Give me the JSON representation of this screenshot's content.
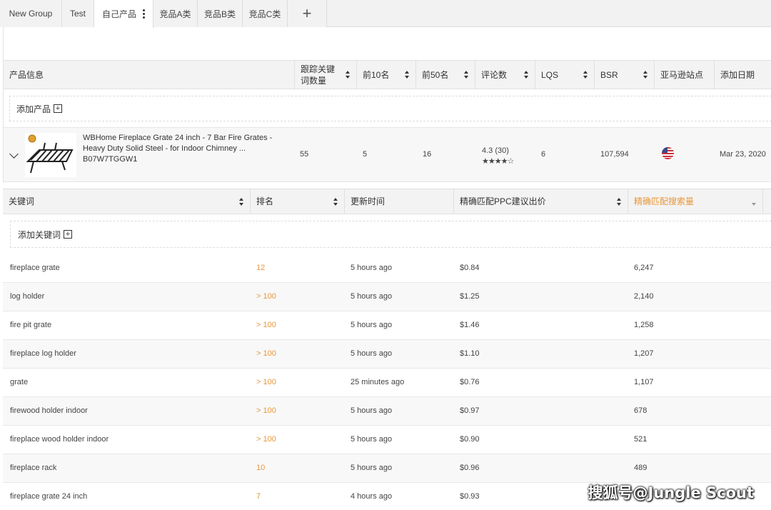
{
  "tabs": [
    {
      "label": "New Group",
      "active": false
    },
    {
      "label": "Test",
      "active": false
    },
    {
      "label": "自己产品",
      "active": true
    },
    {
      "label": "竞品A类",
      "active": false
    },
    {
      "label": "竞品B类",
      "active": false
    },
    {
      "label": "竞品C类",
      "active": false
    }
  ],
  "product_table": {
    "headers": [
      "产品信息",
      "跟踪关键词数量",
      "前10名",
      "前50名",
      "评论数",
      "LQS",
      "BSR",
      "亚马逊站点",
      "添加日期"
    ],
    "add_product_label": "添加产品",
    "product": {
      "title": "WBHome Fireplace Grate 24 inch - 7 Bar Fire Grates - Heavy Duty Solid Steel - for Indoor Chimney ...",
      "asin": "B07W7TGGW1",
      "tracked_keywords": "55",
      "top10": "5",
      "top50": "16",
      "reviews": "4.3 (30)",
      "rating": 4.3,
      "stars": "★★★★☆",
      "lqs": "6",
      "bsr": "107,594",
      "marketplace_icon": "us-flag-icon",
      "date_added": "Mar 23, 2020"
    }
  },
  "keyword_table": {
    "headers": [
      "关键词",
      "排名",
      "更新时间",
      "精确匹配PPC建议出价",
      "精确匹配搜索量"
    ],
    "active_sort_color": "#e8963a",
    "add_keyword_label": "添加关键词",
    "rows": [
      {
        "keyword": "fireplace grate",
        "rank": "12",
        "updated": "5 hours ago",
        "ppc": "$0.84",
        "volume": "6,247"
      },
      {
        "keyword": "log holder",
        "rank": "> 100",
        "updated": "5 hours ago",
        "ppc": "$1.25",
        "volume": "2,140"
      },
      {
        "keyword": "fire pit grate",
        "rank": "> 100",
        "updated": "5 hours ago",
        "ppc": "$1.46",
        "volume": "1,258"
      },
      {
        "keyword": "fireplace log holder",
        "rank": "> 100",
        "updated": "5 hours ago",
        "ppc": "$1.10",
        "volume": "1,207"
      },
      {
        "keyword": "grate",
        "rank": "> 100",
        "updated": "25 minutes ago",
        "ppc": "$0.76",
        "volume": "1,107"
      },
      {
        "keyword": "firewood holder indoor",
        "rank": "> 100",
        "updated": "5 hours ago",
        "ppc": "$0.97",
        "volume": "678"
      },
      {
        "keyword": "fireplace wood holder indoor",
        "rank": "> 100",
        "updated": "5 hours ago",
        "ppc": "$0.90",
        "volume": "521"
      },
      {
        "keyword": "fireplace rack",
        "rank": "10",
        "updated": "5 hours ago",
        "ppc": "$0.96",
        "volume": "489"
      },
      {
        "keyword": "fireplace grate 24 inch",
        "rank": "7",
        "updated": "4 hours ago",
        "ppc": "$0.93",
        "volume": ""
      }
    ]
  },
  "watermark": "搜狐号@Jungle Scout"
}
